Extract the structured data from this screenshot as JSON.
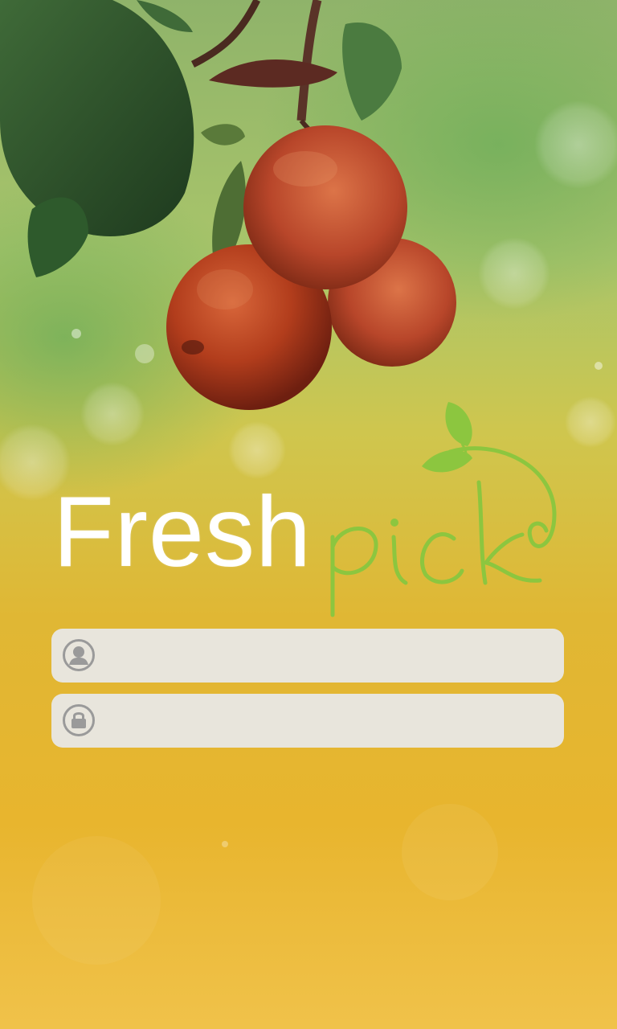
{
  "logo": {
    "word_fresh": "Fresh",
    "word_pick": "pick"
  },
  "login": {
    "username": {
      "value": "",
      "placeholder": "",
      "icon": "user-icon"
    },
    "password": {
      "value": "",
      "placeholder": "",
      "icon": "lock-icon"
    }
  },
  "colors": {
    "brand_green": "#8cc63f",
    "field_bg": "#e8e8ea",
    "icon_gray": "#9a9a9a"
  }
}
